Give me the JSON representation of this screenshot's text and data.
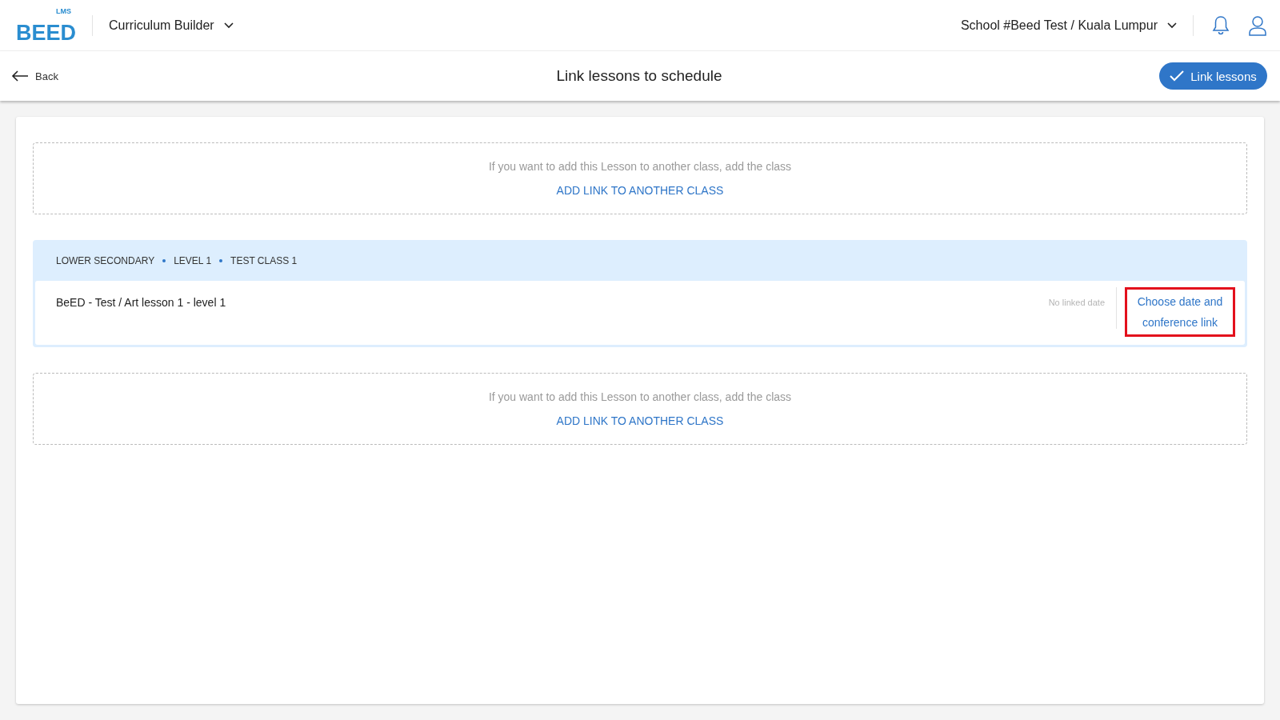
{
  "header": {
    "logo": {
      "text": "BEED",
      "badge": "LMS"
    },
    "module": "Curriculum Builder",
    "school": "School #Beed Test / Kuala Lumpur"
  },
  "toolbar": {
    "back": "Back",
    "title": "Link lessons to schedule",
    "primary_button": "Link lessons"
  },
  "sections": [
    {
      "kind": "add",
      "hint": "If you want to add this Lesson to another class, add the class",
      "action": "ADD LINK TO ANOTHER CLASS"
    },
    {
      "kind": "class",
      "breadcrumb": [
        "LOWER SECONDARY",
        "LEVEL 1",
        "TEST CLASS 1"
      ],
      "lessons": [
        {
          "title": "BeED - Test / Art lesson 1 - level 1",
          "date_status": "No linked date",
          "action": "Choose date and conference link",
          "highlighted": true
        }
      ]
    },
    {
      "kind": "add",
      "hint": "If you want to add this Lesson to another class, add the class",
      "action": "ADD LINK TO ANOTHER CLASS"
    }
  ]
}
